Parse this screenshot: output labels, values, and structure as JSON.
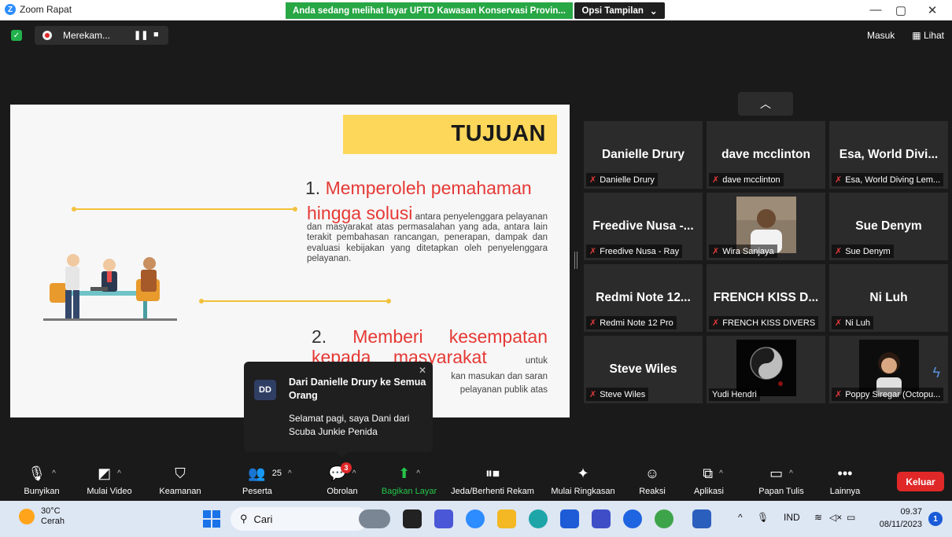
{
  "window": {
    "app_title": "Zoom Rapat",
    "share_banner": "Anda sedang melihat layar UPTD Kawasan Konservasi Provin...",
    "view_options": "Opsi Tampilan",
    "minimize": "—",
    "restore": "▢",
    "close": "✕"
  },
  "recording": {
    "label": "Merekam...",
    "pause": "❚❚",
    "stop": "■"
  },
  "top_right": {
    "signin": "Masuk",
    "view": "Lihat"
  },
  "slide": {
    "heading": "TUJUAN",
    "point1_num": "1.",
    "point1_head_a": "Memperoleh pemahaman",
    "point1_head_b": "hingga solusi",
    "point1_body_a": "antara penyelenggara",
    "point1_body_b": "pelayanan dan masyarakat atas permasalahan yang ada, antara lain terakit pembahasan rancangan, penerapan, dampak dan evaluasi kebijakan yang ditetapkan oleh penyelenggara pelayanan.",
    "point2_num": "2.",
    "point2_w1": "Memberi",
    "point2_w2": "kesempatan",
    "point2_sub_a": "kepada",
    "point2_sub_b": "masyarakat",
    "point2_untuk": "untuk",
    "point2_line1": "kan masukan dan saran",
    "point2_line2": "pelayanan publik atas"
  },
  "gallery": {
    "tiles": [
      {
        "name": "Danielle Drury",
        "label": "Danielle Drury"
      },
      {
        "name": "dave mcclinton",
        "label": "dave mcclinton"
      },
      {
        "name": "Esa, World Divi...",
        "label": "Esa, World Diving Lem..."
      },
      {
        "name": "Freedive Nusa -...",
        "label": "Freedive Nusa - Ray"
      },
      {
        "name": "",
        "label": "Wira Sanjaya"
      },
      {
        "name": "Sue Denym",
        "label": "Sue Denym"
      },
      {
        "name": "Redmi Note 12...",
        "label": "Redmi Note 12 Pro"
      },
      {
        "name": "FRENCH KISS D...",
        "label": "FRENCH KISS DIVERS"
      },
      {
        "name": "Ni Luh",
        "label": "Ni Luh"
      },
      {
        "name": "Steve Wiles",
        "label": "Steve Wiles"
      },
      {
        "name": "",
        "label": "Yudi Hendri"
      },
      {
        "name": "",
        "label": "Poppy Siregar (Octopu..."
      }
    ]
  },
  "chat_toast": {
    "avatar": "DD",
    "title": "Dari Danielle Drury ke Semua Orang",
    "message": "Selamat pagi, saya Dani dari Scuba Junkie Penida"
  },
  "toolbar": {
    "unmute": "Bunyikan",
    "start_video": "Mulai Video",
    "security": "Keamanan",
    "participants": "Peserta",
    "participants_count": "25",
    "chat": "Obrolan",
    "chat_badge": "3",
    "share": "Bagikan Layar",
    "pause_record": "Jeda/Berhenti Rekam",
    "summary": "Mulai Ringkasan",
    "reactions": "Reaksi",
    "apps": "Aplikasi",
    "whiteboard": "Papan Tulis",
    "more": "Lainnya",
    "leave": "Keluar"
  },
  "taskbar": {
    "temperature": "30°C",
    "weather": "Cerah",
    "search": "Cari",
    "language": "IND",
    "time": "09.37",
    "date": "08/11/2023",
    "notif_count": "1"
  },
  "colors": {
    "share_green": "#28a745",
    "slide_yellow": "#fdd75a",
    "slide_red": "#e53935",
    "leave_red": "#e02828",
    "zoom_blue": "#2d8cff"
  }
}
